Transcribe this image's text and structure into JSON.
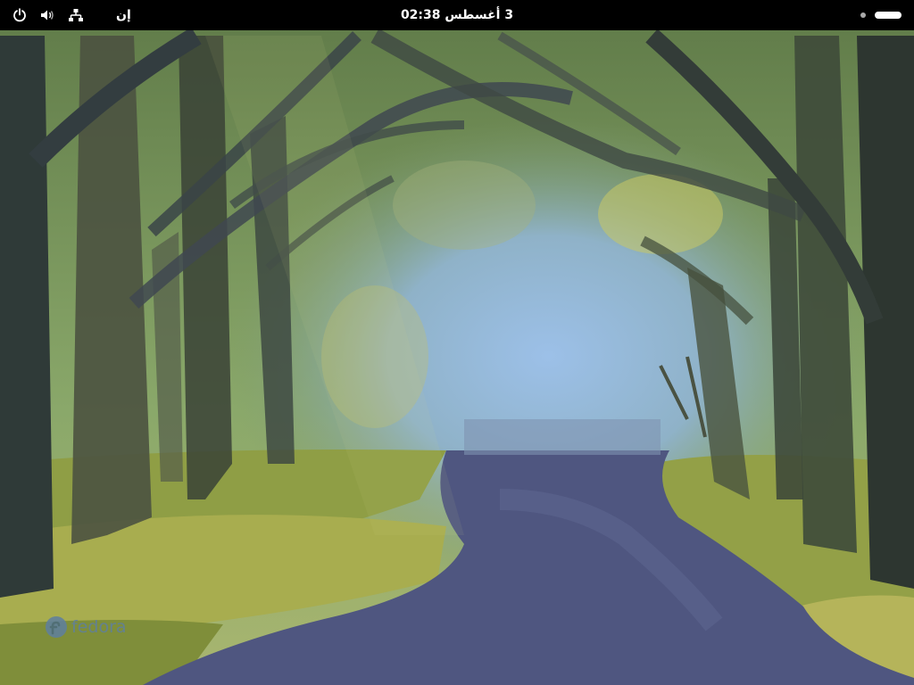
{
  "topbar": {
    "activities_label": "إن",
    "clock": "3 أغسطس  02:38"
  },
  "icons": {
    "power": "power-icon",
    "volume": "volume-icon",
    "network": "network-wired-icon"
  },
  "watermark": {
    "text": "fedora"
  },
  "colors": {
    "topbar": "#000000",
    "road": "#4f5680",
    "grass": "#8a9a40",
    "sky": "#8fb0d8"
  }
}
